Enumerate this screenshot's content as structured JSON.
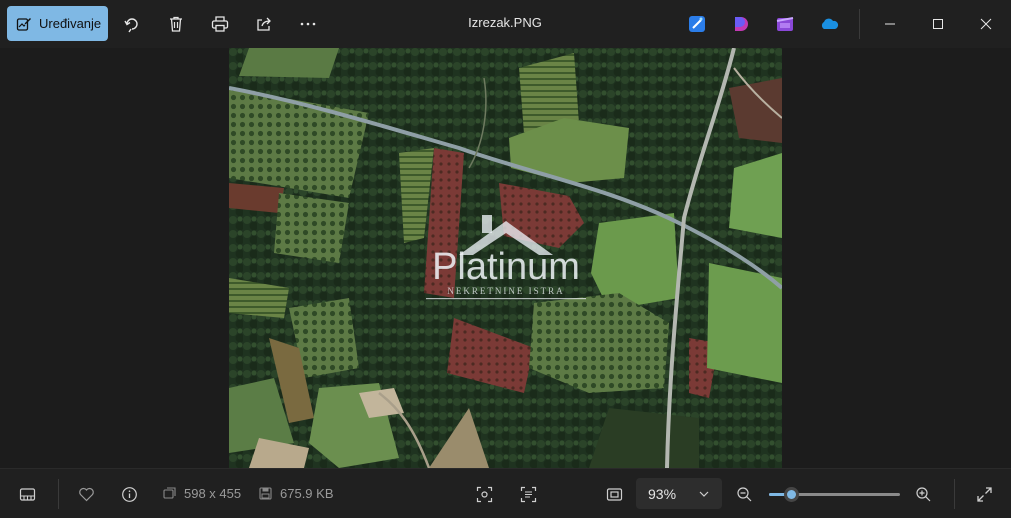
{
  "toolbar": {
    "edit_label": "Uređivanje",
    "accent": "#7fb8e4",
    "icons": [
      "rotate-icon",
      "delete-icon",
      "print-icon",
      "share-icon",
      "more-icon"
    ]
  },
  "window": {
    "title": "Izrezak.PNG"
  },
  "image": {
    "watermark_brand": "Platinum",
    "watermark_tagline": "NEKRETNINE ISTRA"
  },
  "status": {
    "dimensions": "598 x 455",
    "file_size": "675.9 KB",
    "zoom_label": "93%",
    "zoom_fraction": 0.17
  }
}
